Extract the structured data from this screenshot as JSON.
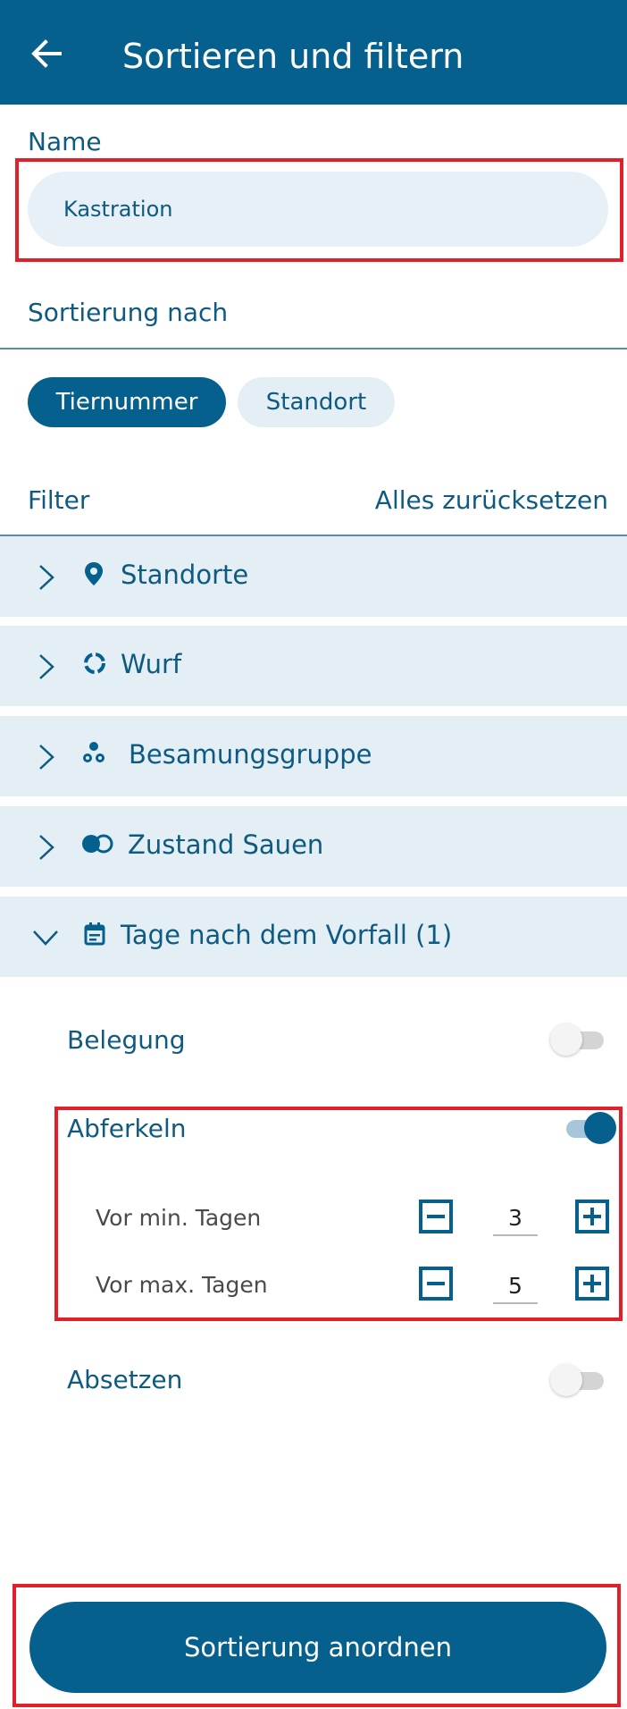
{
  "header": {
    "title": "Sortieren und filtern",
    "back_icon": "arrow-left-icon"
  },
  "name": {
    "label": "Name",
    "value": "Kastration"
  },
  "sort": {
    "label": "Sortierung nach",
    "chips": [
      {
        "label": "Tiernummer",
        "active": true
      },
      {
        "label": "Standort",
        "active": false
      }
    ]
  },
  "filter": {
    "label": "Filter",
    "reset": "Alles zurücksetzen",
    "sections": [
      {
        "label": "Standorte",
        "icon": "location-pin-icon",
        "expanded": false
      },
      {
        "label": "Wurf",
        "icon": "litter-ring-icon",
        "expanded": false
      },
      {
        "label": "Besamungsgruppe",
        "icon": "pig-group-icon",
        "expanded": false
      },
      {
        "label": "Zustand Sauen",
        "icon": "toggle-state-icon",
        "expanded": false
      },
      {
        "label": "Tage nach dem Vorfall (1)",
        "icon": "calendar-icon",
        "expanded": true
      }
    ],
    "events": [
      {
        "label": "Belegung",
        "enabled": false
      },
      {
        "label": "Abferkeln",
        "enabled": true,
        "min_label": "Vor min. Tagen",
        "min_value": "3",
        "max_label": "Vor max. Tagen",
        "max_value": "5"
      },
      {
        "label": "Absetzen",
        "enabled": false
      }
    ]
  },
  "primary_button": "Sortierung anordnen",
  "colors": {
    "primary": "#06608e",
    "section_bg": "#e3eef5",
    "highlight": "#e1202a"
  }
}
